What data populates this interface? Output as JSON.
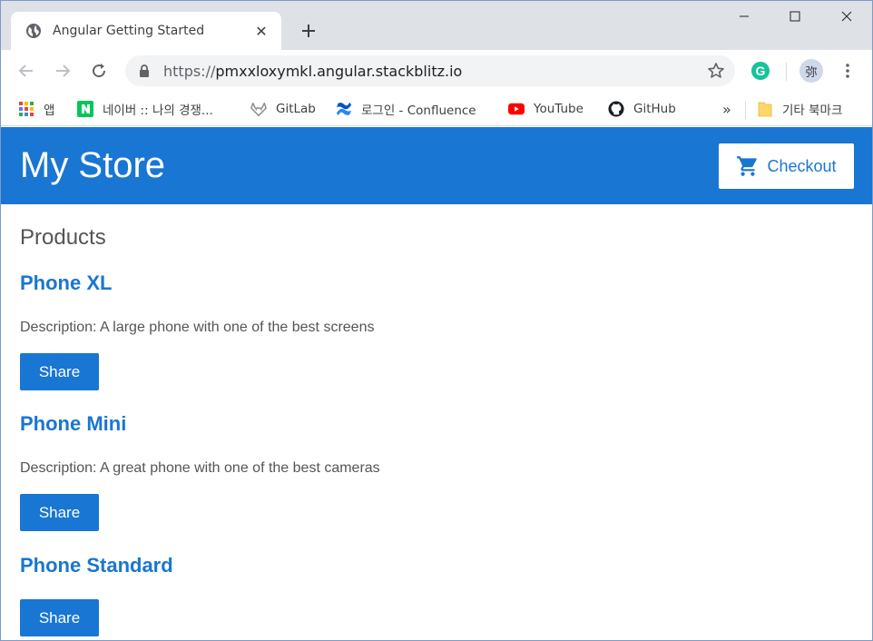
{
  "browser": {
    "tab_title": "Angular Getting Started",
    "tab_close": "✕",
    "new_tab": "+",
    "url_scheme": "https://",
    "url_host": "pmxxloxymkl.angular.stackblitz.io",
    "extension_grammarly": "G",
    "profile_initial": "弥",
    "bookmarks": [
      {
        "label": "앱",
        "icon": "apps-grid-icon"
      },
      {
        "label": "네이버 :: 나의 경쟁...",
        "icon": "naver-icon"
      },
      {
        "label": "GitLab",
        "icon": "gitlab-icon"
      },
      {
        "label": "로그인 - Confluence",
        "icon": "confluence-icon"
      },
      {
        "label": "YouTube",
        "icon": "youtube-icon"
      },
      {
        "label": "GitHub",
        "icon": "github-icon"
      }
    ],
    "more_bookmarks": "»",
    "other_bookmarks": "기타 북마크"
  },
  "app": {
    "title": "My Store",
    "checkout_label": "Checkout",
    "products_heading": "Products",
    "brand_color": "#1976d2",
    "products": [
      {
        "name": "Phone XL",
        "description": "Description: A large phone with one of the best screens",
        "share_label": "Share"
      },
      {
        "name": "Phone Mini",
        "description": "Description: A great phone with one of the best cameras",
        "share_label": "Share"
      },
      {
        "name": "Phone Standard",
        "share_label": "Share"
      }
    ]
  }
}
